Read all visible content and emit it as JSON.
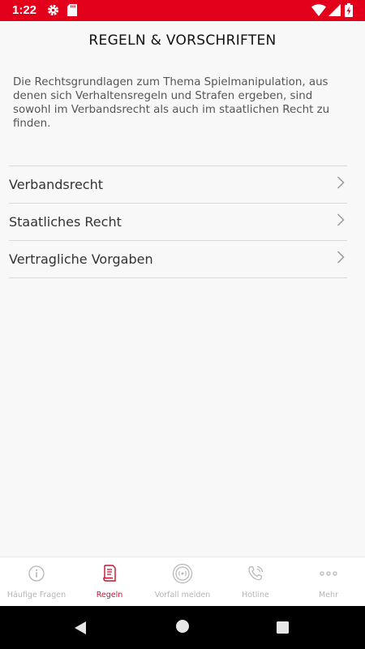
{
  "status_bar": {
    "time": "1:22"
  },
  "page": {
    "title": "REGELN & VORSCHRIFTEN",
    "intro": "Die Rechtsgrundlagen zum Thema Spielmanipulation, aus denen sich Verhaltensregeln und Strafen ergeben, sind sowohl im Verbandsrecht als auch im staatlichen Recht zu finden."
  },
  "menu": {
    "items": [
      {
        "label": "Verbandsrecht"
      },
      {
        "label": "Staatliches Recht"
      },
      {
        "label": "Vertragliche Vorgaben"
      }
    ]
  },
  "tabs": [
    {
      "label": "Häufige Fragen",
      "icon": "info-icon"
    },
    {
      "label": "Regeln",
      "icon": "document-icon",
      "active": true
    },
    {
      "label": "Vorfall melden",
      "icon": "report-icon"
    },
    {
      "label": "Hotline",
      "icon": "phone-icon"
    },
    {
      "label": "Mehr",
      "icon": "more-icon"
    }
  ],
  "colors": {
    "status_bar": "#e2001a",
    "accent": "#c8102e",
    "inactive": "#b5b5b5",
    "background": "#f8f8f8"
  }
}
